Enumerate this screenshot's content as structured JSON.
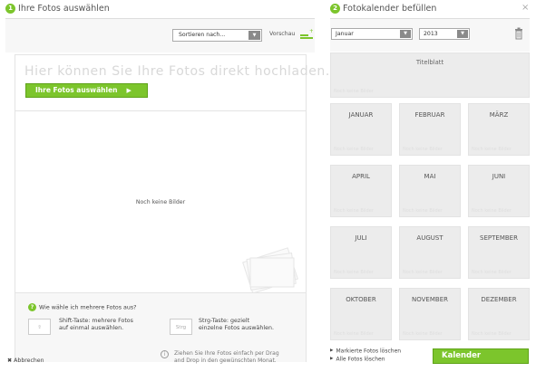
{
  "left_panel": {
    "step_number": "1",
    "title": "Ihre Fotos auswählen",
    "sort_select": {
      "value": "Sortieren nach..."
    },
    "preview_label": "Vorschau",
    "upload_hint": "Hier können Sie Ihre Fotos direkt hochladen.",
    "choose_button": "Ihre Fotos auswählen",
    "no_images": "Noch keine Bilder",
    "help": {
      "question": "Wie wähle ich mehrere Fotos aus?",
      "shift_key": "⇧",
      "shift_text_line1": "Shift-Taste: mehrere Fotos",
      "shift_text_line2": "auf einmal auswählen.",
      "strg_key": "Strg",
      "strg_text_line1": "Strg-Taste: gezielt",
      "strg_text_line2": "einzelne Fotos auswählen."
    },
    "cancel": "Abbrechen",
    "drag_hint_line1": "Ziehen Sie Ihre Fotos einfach per Drag",
    "drag_hint_line2": "and Drop in den gewünschten Monat."
  },
  "right_panel": {
    "step_number": "2",
    "title": "Fotokalender befüllen",
    "close": "×",
    "month_select": {
      "value": "Januar"
    },
    "year_select": {
      "value": "2013"
    },
    "cover_label": "Titelblatt",
    "no_images": "Noch keine Bilder",
    "months": [
      "JANUAR",
      "FEBRUAR",
      "MÄRZ",
      "APRIL",
      "MAI",
      "JUNI",
      "JULI",
      "AUGUST",
      "SEPTEMBER",
      "OKTOBER",
      "NOVEMBER",
      "DEZEMBER"
    ],
    "delete_selected": "Markierte Fotos löschen",
    "delete_all": "Alle Fotos löschen",
    "create_button": "Kalender gestalten"
  },
  "colors": {
    "accent_green": "#7cc52c",
    "tile_gray": "#ececec"
  }
}
